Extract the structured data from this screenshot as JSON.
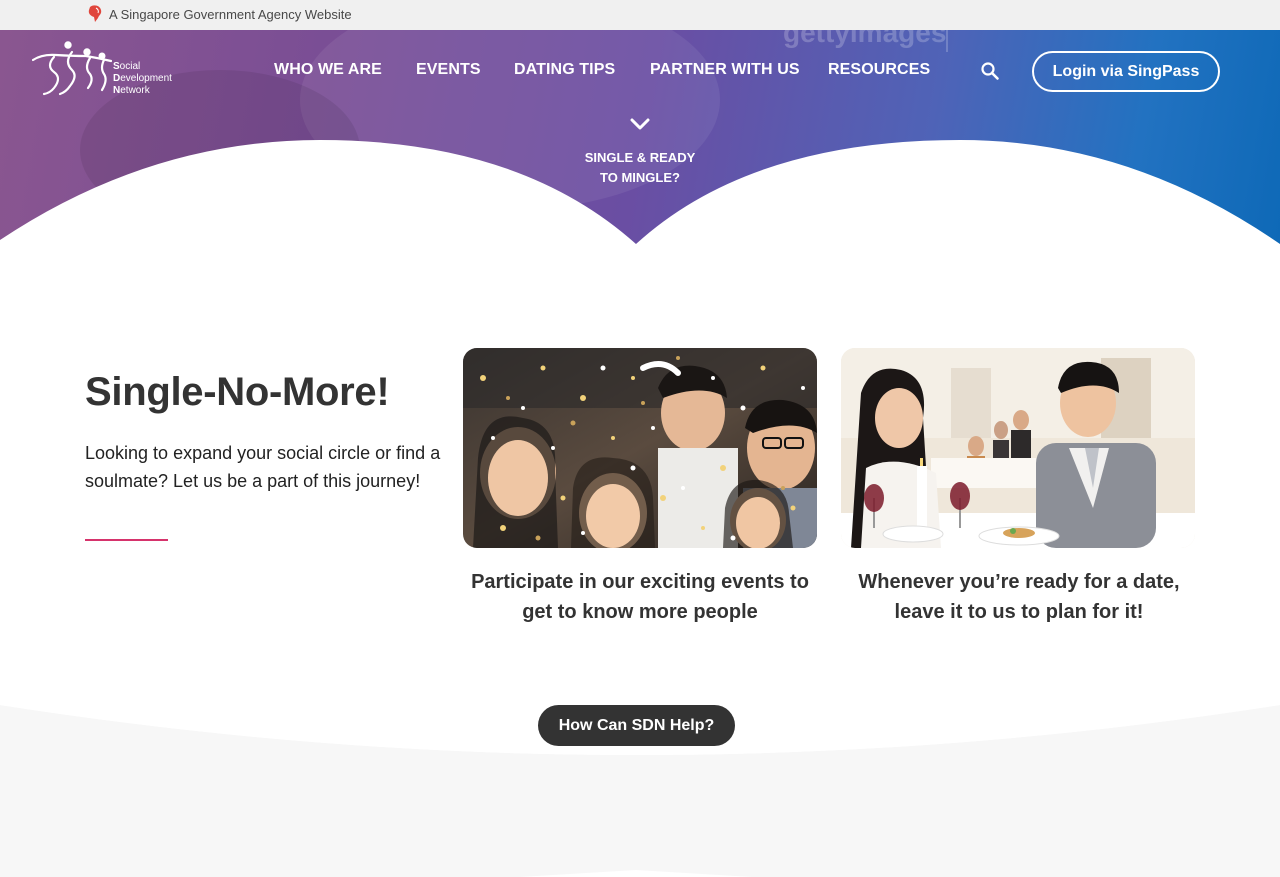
{
  "gov_bar": {
    "text": "A Singapore Government Agency Website"
  },
  "hero": {
    "watermark": "gettyimages"
  },
  "logo": {
    "line1_initial": "S",
    "line1_rest": "ocial",
    "line2_initial": "D",
    "line2_rest": "evelopment",
    "line3_initial": "N",
    "line3_rest": "etwork"
  },
  "nav": {
    "items": [
      {
        "label": "WHO WE ARE"
      },
      {
        "label": "EVENTS"
      },
      {
        "label": "DATING TIPS"
      },
      {
        "label": "PARTNER WITH US"
      },
      {
        "label": "RESOURCES"
      }
    ],
    "search_icon": "search-icon",
    "login_label": "Login via SingPass"
  },
  "scroll_prompt": {
    "line1": "SINGLE & READY",
    "line2": "TO MINGLE?",
    "icon": "chevron-down-icon"
  },
  "intro": {
    "title": "Single-No-More!",
    "text": "Looking to expand your social circle or find a soulmate? Let us be a part of this journey!"
  },
  "cards": [
    {
      "caption": "Participate in our exciting events to get to know more people"
    },
    {
      "caption": "Whenever you’re ready for a date, leave it to us to plan for it!"
    }
  ],
  "help": {
    "label": "How Can SDN Help?"
  },
  "colors": {
    "accent": "#d6336c",
    "dark_button": "#333333",
    "hero_start": "#8a5690",
    "hero_end": "#0e69b7"
  }
}
